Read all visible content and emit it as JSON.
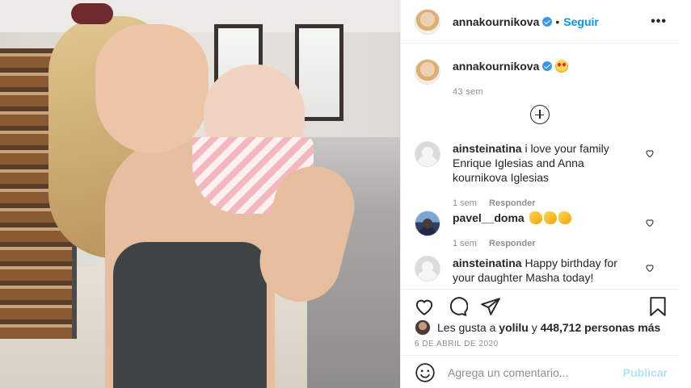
{
  "post": {
    "image_alt": "Foto de annakournikova"
  },
  "header": {
    "username": "annakournikova",
    "separator": "•",
    "follow_label": "Seguir",
    "more_icon": "more-options-icon"
  },
  "caption": {
    "username": "annakournikova",
    "emoji": "smiling-face-with-heart-eyes",
    "time": "43 sem"
  },
  "load_more_icon": "add-circle-icon",
  "comments": [
    {
      "username": "ainsteinatina",
      "text": "i love your family Enrique Iglesias and Anna kournikova Iglesias",
      "time": "1 sem",
      "reply_label": "Responder"
    },
    {
      "username": "pavel__doma",
      "text": "",
      "emoji": "clapping-hands x3",
      "time": "1 sem",
      "reply_label": "Responder"
    },
    {
      "username": "ainsteinatina",
      "text": "Happy birthday for your daughter Masha today!",
      "time": "",
      "reply_label": ""
    }
  ],
  "actions": {
    "like_icon": "heart-icon",
    "comment_icon": "comment-icon",
    "share_icon": "share-icon",
    "save_icon": "bookmark-icon"
  },
  "likes": {
    "prefix": "Les gusta a",
    "first_user": "yolilu",
    "joiner": "y",
    "count_text": "448,712 personas más"
  },
  "date": "6 DE ABRIL DE 2020",
  "add_comment": {
    "placeholder": "Agrega un comentario...",
    "publish_label": "Publicar",
    "emoji_icon": "emoji-icon"
  },
  "colors": {
    "accent": "#0095f6",
    "publish_disabled": "#b2dffc",
    "verified": "#3897f0",
    "secondary_text": "#8e8e8e"
  }
}
